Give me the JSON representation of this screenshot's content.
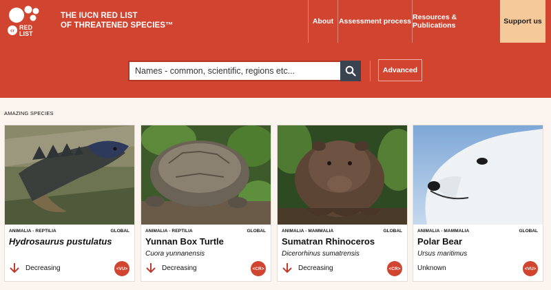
{
  "header": {
    "logo_text": "RED LIST",
    "brand_line1": "THE IUCN RED LIST",
    "brand_line2": "OF THREATENED SPECIES™",
    "nav": [
      "About",
      "Assessment process",
      "Resources & Publications",
      "Support us"
    ]
  },
  "search": {
    "placeholder": "Names - common, scientific, regions etc...",
    "advanced_label": "Advanced"
  },
  "section": {
    "title": "AMAZING SPECIES"
  },
  "cards": [
    {
      "taxonomy": "ANIMALIA - REPTILIA",
      "scope": "GLOBAL",
      "name": "Hydrosaurus pustulatus",
      "scientific": "",
      "trend": "Decreasing",
      "category": "VU"
    },
    {
      "taxonomy": "ANIMALIA - REPTILIA",
      "scope": "GLOBAL",
      "name": "Yunnan Box Turtle",
      "scientific": "Cuora yunnanensis",
      "trend": "Decreasing",
      "category": "CR"
    },
    {
      "taxonomy": "ANIMALIA - MAMMALIA",
      "scope": "GLOBAL",
      "name": "Sumatran Rhinoceros",
      "scientific": "Dicerorhinus sumatrensis",
      "trend": "Decreasing",
      "category": "CR"
    },
    {
      "taxonomy": "ANIMALIA - MAMMALIA",
      "scope": "GLOBAL",
      "name": "Polar Bear",
      "scientific": "Ursus maritimus",
      "trend": "Unknown",
      "category": "VU"
    }
  ],
  "colors": {
    "brand_red": "#d04430",
    "support_bg": "#f6c99a",
    "search_button": "#3a4450"
  }
}
